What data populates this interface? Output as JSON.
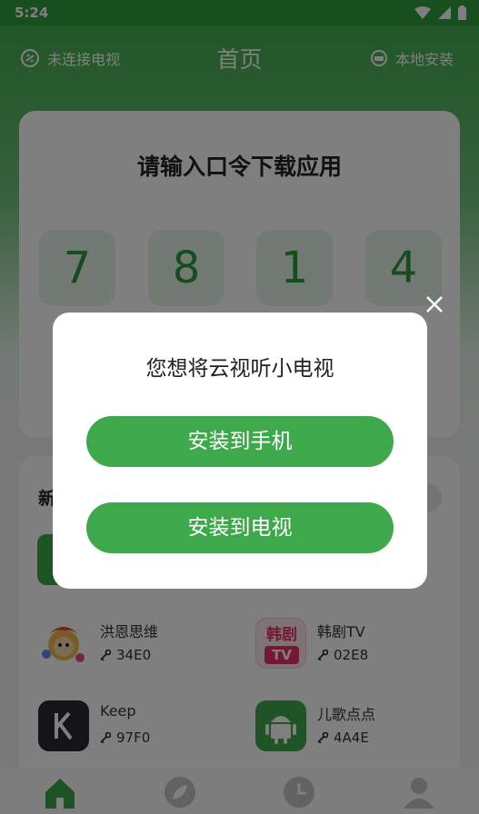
{
  "status_bar": {
    "time": "5:24"
  },
  "topbar": {
    "tv_status": "未连接电视",
    "title": "首页",
    "local_install": "本地安装"
  },
  "code_card": {
    "heading": "请输入口令下载应用",
    "digits": [
      "7",
      "8",
      "1",
      "4"
    ]
  },
  "new_apps": {
    "title": "新",
    "apps": [
      {
        "name": "洪恩思维",
        "code": "34E0",
        "icon": "honger-thinking-logo"
      },
      {
        "name": "韩剧TV",
        "code": "02E8",
        "icon": "korean-drama-tv-logo",
        "icon_text": "韩剧",
        "icon_text2": "TV"
      },
      {
        "name": "Keep",
        "code": "97F0",
        "icon": "keep-logo"
      },
      {
        "name": "儿歌点点",
        "code": "4A4E",
        "icon": "android-logo"
      }
    ]
  },
  "bottom_nav": [
    "home-icon",
    "discover-icon",
    "history-icon",
    "profile-icon"
  ],
  "dialog": {
    "message": "您想将云视听小电视",
    "install_phone": "安装到手机",
    "install_tv": "安装到电视"
  },
  "colors": {
    "primary_green": "#3da94b",
    "digit_green": "#2c9b3a",
    "arrow_red": "#e94b35"
  }
}
